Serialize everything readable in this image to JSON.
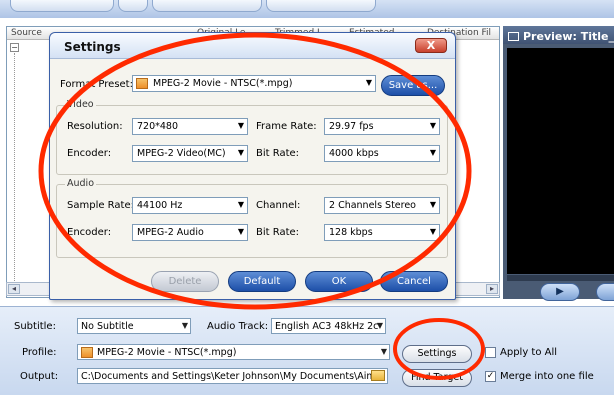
{
  "list": {
    "columns": [
      "Source",
      "Original Le...",
      "Trimmed L...",
      "Estimated ...",
      "Destination Fil"
    ]
  },
  "preview": {
    "title": "Preview: Title_"
  },
  "bottom": {
    "subtitle_label": "Subtitle:",
    "subtitle_value": "No Subtitle",
    "audio_track_label": "Audio Track:",
    "audio_track_value": "English AC3 48kHz 2c",
    "profile_label": "Profile:",
    "profile_value": "MPEG-2 Movie - NTSC(*.mpg)",
    "output_label": "Output:",
    "output_value": "C:\\Documents and Settings\\Keter Johnson\\My Documents\\Aime",
    "settings_button": "Settings",
    "find_target_button": "Find Target",
    "apply_to_all_label": "Apply to All",
    "apply_to_all_checked": false,
    "merge_label": "Merge into one file",
    "merge_checked": true
  },
  "dialog": {
    "title": "Settings",
    "close_label": "X",
    "format_preset_label": "Format Preset:",
    "format_preset_value": "MPEG-2 Movie - NTSC(*.mpg)",
    "save_as_button": "Save as...",
    "video_group_label": "Video",
    "resolution_label": "Resolution:",
    "resolution_value": "720*480",
    "frame_rate_label": "Frame Rate:",
    "frame_rate_value": "29.97 fps",
    "video_encoder_label": "Encoder:",
    "video_encoder_value": "MPEG-2 Video(MC)",
    "video_bitrate_label": "Bit Rate:",
    "video_bitrate_value": "4000 kbps",
    "audio_group_label": "Audio",
    "sample_rate_label": "Sample Rate:",
    "sample_rate_value": "44100 Hz",
    "channel_label": "Channel:",
    "channel_value": "2 Channels Stereo",
    "audio_encoder_label": "Encoder:",
    "audio_encoder_value": "MPEG-2 Audio",
    "audio_bitrate_label": "Bit Rate:",
    "audio_bitrate_value": "128 kbps",
    "delete_button": "Delete",
    "default_button": "Default",
    "ok_button": "OK",
    "cancel_button": "Cancel"
  },
  "colors": {
    "annotation": "#ff2a00",
    "button_blue": "#1d4fa8"
  },
  "icons": [
    "play-icon",
    "dropdown-arrow-icon",
    "folder-icon",
    "close-icon",
    "file-format-icon"
  ]
}
